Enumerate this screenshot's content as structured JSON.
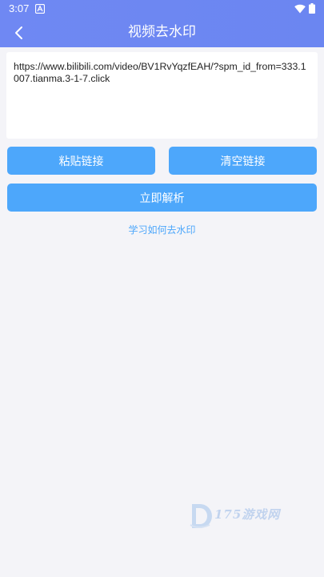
{
  "status_bar": {
    "time": "3:07",
    "notification_icon": "a-letter-icon",
    "wifi_icon": "wifi-icon",
    "battery_icon": "battery-icon"
  },
  "header": {
    "title": "视频去水印",
    "back_icon": "chevron-left-icon"
  },
  "url_input": {
    "value": "https://www.bilibili.com/video/BV1RvYqzfEAH/?spm_id_from=333.1007.tianma.3-1-7.click"
  },
  "buttons": {
    "paste_label": "粘贴链接",
    "clear_label": "清空链接",
    "parse_label": "立即解析"
  },
  "learn_link": "学习如何去水印",
  "watermark": {
    "text": "175游戏网"
  },
  "colors": {
    "header": "#6f88f3",
    "button": "#4da7fb",
    "link": "#4da7fb",
    "background": "#f4f4f8"
  }
}
